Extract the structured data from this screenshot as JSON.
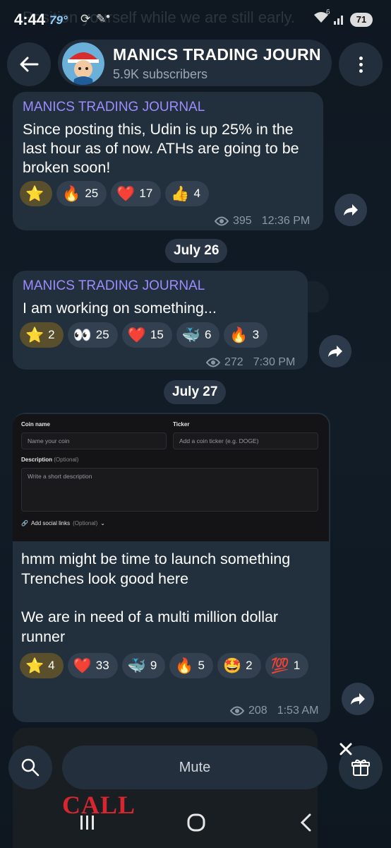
{
  "status_bar": {
    "time": "4:44",
    "temp": "79°",
    "ghost_text": "Position yourself while we are still early.",
    "battery": "71",
    "signal_badge": "6"
  },
  "header": {
    "title": "MANICS TRADING JOURN",
    "subscribers": "5.9K subscribers"
  },
  "messages": [
    {
      "sender": "MANICS TRADING JOURNAL",
      "text": "Since posting this, Udin is up 25% in the last hour as of now. ATHs are going to be broken soon!",
      "reactions": [
        {
          "emoji": "⭐",
          "count": ""
        },
        {
          "emoji": "🔥",
          "count": "25"
        },
        {
          "emoji": "❤️",
          "count": "17"
        },
        {
          "emoji": "👍",
          "count": "4"
        }
      ],
      "views": "395",
      "time": "12:36 PM"
    },
    {
      "sender": "MANICS TRADING JOURNAL",
      "text": "I am working on something...",
      "reactions": [
        {
          "emoji": "⭐",
          "count": "2"
        },
        {
          "emoji": "👀",
          "count": "25"
        },
        {
          "emoji": "❤️",
          "count": "15"
        },
        {
          "emoji": "🐳",
          "count": "6"
        },
        {
          "emoji": "🔥",
          "count": "3"
        }
      ],
      "views": "272",
      "time": "7:30 PM"
    },
    {
      "image_form": {
        "coin_name_label": "Coin name",
        "coin_name_placeholder": "Name your coin",
        "ticker_label": "Ticker",
        "ticker_placeholder": "Add a coin ticker (e.g. DOGE)",
        "description_label": "Description",
        "description_optional": "(Optional)",
        "description_placeholder": "Write a short description",
        "social_links": "Add social links",
        "social_optional": "(Optional)"
      },
      "text_line1": "hmm might be time to launch something",
      "text_line2": "Trenches look good here",
      "text_line3": "We are in need of a multi million dollar",
      "text_line4": "runner",
      "reactions": [
        {
          "emoji": "⭐",
          "count": "4"
        },
        {
          "emoji": "❤️",
          "count": "33"
        },
        {
          "emoji": "🐳",
          "count": "9"
        },
        {
          "emoji": "🔥",
          "count": "5"
        },
        {
          "emoji": "🤩",
          "count": "2"
        },
        {
          "emoji": "💯",
          "count": "1"
        }
      ],
      "views": "208",
      "time": "1:53 AM"
    }
  ],
  "dates": [
    "July 26",
    "July 27"
  ],
  "bottom": {
    "mute_label": "Mute",
    "partial_card_text": "CALL"
  },
  "colors": {
    "sender": "#9d8cff",
    "bubble": "#222f3d",
    "background": "#101a24"
  }
}
